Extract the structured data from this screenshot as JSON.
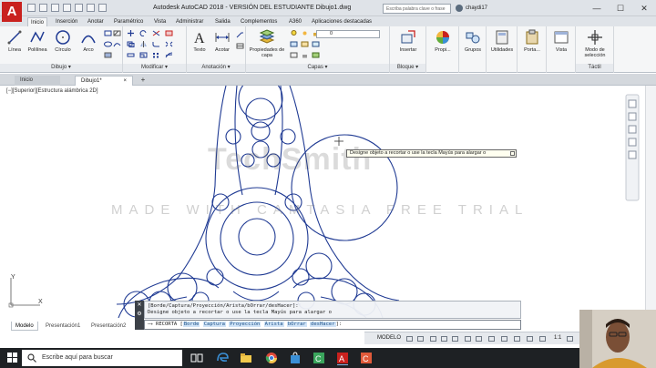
{
  "app": {
    "logo_letter": "A",
    "title": "Autodesk AutoCAD 2018 - VERSIÓN DEL ESTUDIANTE    Dibujo1.dwg",
    "search_placeholder": "Escriba palabra clave o frase",
    "user": "chaydi17",
    "window_controls": [
      "—",
      "☐",
      "✕"
    ]
  },
  "ribbon_tabs": [
    "Inicio",
    "Inserción",
    "Anotar",
    "Paramétrico",
    "Vista",
    "Administrar",
    "Salida",
    "Complementos",
    "A360",
    "Aplicaciones destacadas"
  ],
  "ribbon": {
    "draw_tools": [
      "Línea",
      "Polilínea",
      "Círculo",
      "Arco"
    ],
    "panels": [
      "Dibujo ▾",
      "Modificar ▾",
      "Anotación ▾",
      "Capas ▾",
      "Bloque ▾",
      "Táctil"
    ],
    "text_tool": "Texto",
    "dim_tool": "Acotar",
    "layer_props": "Propiedades de capa",
    "layer_value": "0",
    "insert": "Insertar",
    "properties": "Propi...",
    "groups": "Grupos",
    "utilities": "Utilidades",
    "clipboard": "Porta...",
    "view": "Vista",
    "selection_mode": "Modo de selección"
  },
  "doc_tabs": {
    "start": "Inicio",
    "drawing": "Dibujo1*",
    "close": "×",
    "add": "+"
  },
  "canvas": {
    "view_label": "[−][Superior][Estructura alámbrica 2D]",
    "tooltip": "Designe objeto a recortar o use la tecla Mayús para alargar o",
    "watermark_brand": "TechSmith",
    "watermark_line": "MADE WITH CAMTASIA FREE TRIAL",
    "ucs_y": "Y",
    "ucs_x": "X"
  },
  "command": {
    "history": [
      "[Borde/Captura/Proyección/Arista/bOrrar/desHacer]:",
      "Designe objeto a recortar o use la tecla Mayús para alargar o"
    ],
    "prompt_prefix": "RECORTA",
    "options": [
      "Borde",
      "Captura",
      "Proyección",
      "Arista",
      "bOrrar",
      "desHacer"
    ],
    "suffix": "]:"
  },
  "layout_tabs": [
    "Modelo",
    "Presentación1",
    "Presentación2"
  ],
  "status": {
    "mode": "MODELO",
    "scale": "1:1"
  },
  "taskbar": {
    "search_text": "Escribe aquí para buscar"
  },
  "colors": {
    "drawing_stroke": "#1f3a93",
    "autocad_red": "#c9211e"
  }
}
